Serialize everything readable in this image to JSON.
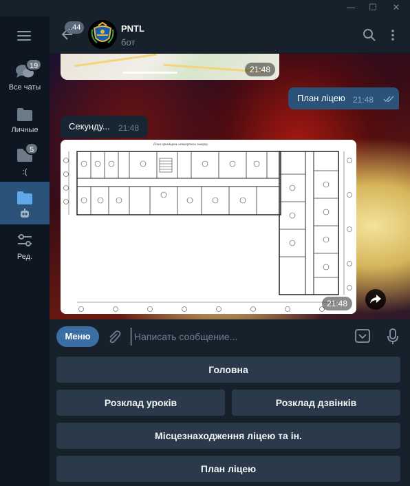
{
  "window": {
    "minimize": "—",
    "maximize": "☐",
    "close": "✕"
  },
  "sidebar": {
    "menu_icon": "hamburger-icon",
    "folders": [
      {
        "label": "Все чаты",
        "badge": "19",
        "icon": "chats-icon"
      },
      {
        "label": "Личные",
        "badge": "",
        "icon": "folder-icon"
      },
      {
        "label": ":(",
        "badge": "5",
        "icon": "folder-icon"
      },
      {
        "label": "",
        "badge": "",
        "icon": "folder-bot-icon",
        "active": true
      },
      {
        "label": "Ред.",
        "badge": "",
        "icon": "edit-icon"
      }
    ]
  },
  "header": {
    "back_badge": "..44",
    "chat_name": "PNTL",
    "chat_subtitle": "бот"
  },
  "messages": {
    "map_time": "21:48",
    "outgoing_text": "План ліцею",
    "outgoing_time": "21:48",
    "incoming_text": "Секунду...",
    "incoming_time": "21:48",
    "photo_caption": "План приміщень четвертого поверху",
    "photo_time": "21:48"
  },
  "composer": {
    "menu_label": "Меню",
    "placeholder": "Написать сообщение..."
  },
  "keyboard": {
    "buttons": [
      "Головна",
      "Розклад уроків",
      "Розклад дзвінків",
      "Місцезнаходження ліцею та ін.",
      "План ліцею"
    ]
  },
  "colors": {
    "accent": "#2b5278",
    "menu_button": "#3a6ea5",
    "bg": "#17212b",
    "rail": "#0e1621"
  }
}
